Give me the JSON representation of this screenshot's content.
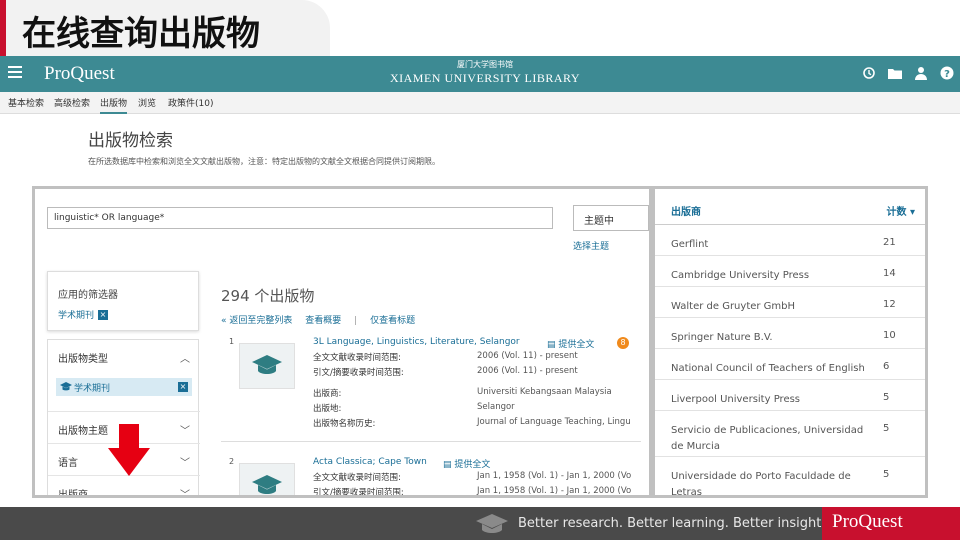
{
  "slide": {
    "title": "在线查询出版物"
  },
  "header": {
    "brand": "ProQuest",
    "library_sub": "厦门大学图书馆",
    "library_name": "XIAMEN UNIVERSITY LIBRARY",
    "icons": [
      "history-icon",
      "folder-icon",
      "user-icon",
      "help-icon"
    ]
  },
  "nav": {
    "items": [
      "基本检索",
      "高级检索",
      "出版物",
      "浏览",
      "政策件(10)"
    ],
    "active": "出版物"
  },
  "page": {
    "title": "出版物检索",
    "description": "在所选数据库中检索和浏览全文文献出版物，注意：特定出版物的文献全文根据合同提供订阅期限。"
  },
  "search": {
    "value": "linguistic* OR language*",
    "subject_button": "主题中",
    "select_subject": "选择主题"
  },
  "filters": {
    "applied_title": "应用的筛选器",
    "applied_chip": "学术期刊",
    "facets": [
      {
        "label": "出版物类型",
        "chevron": "︿",
        "selected": "学术期刊"
      },
      {
        "label": "出版物主题",
        "chevron": "﹀"
      },
      {
        "label": "语言",
        "chevron": "﹀"
      },
      {
        "label": "出版商",
        "chevron": "﹀"
      }
    ]
  },
  "results": {
    "count": "294 个出版物",
    "links": [
      "« 返回至完整列表",
      "查看概要",
      "|",
      "仅查看标题"
    ],
    "items": [
      {
        "num": "1",
        "title": "3L Language, Linguistics, Literature, Selangor",
        "fulltext": "提供全文",
        "badge": "8",
        "meta": [
          {
            "label": "全文文献收录时间范围:",
            "value": "2006 (Vol. 11) - present"
          },
          {
            "label": "引文/摘要收录时间范围:",
            "value": "2006 (Vol. 11) - present"
          },
          {
            "label": "出版商:",
            "value": "Universiti Kebangsaan Malaysia"
          },
          {
            "label": "出版地:",
            "value": "Selangor"
          },
          {
            "label": "出版物名称历史:",
            "value": "Journal of Language Teaching, Lingu"
          }
        ]
      },
      {
        "num": "2",
        "title": "Acta Classica; Cape Town",
        "fulltext": "提供全文",
        "meta": [
          {
            "label": "全文文献收录时间范围:",
            "value": "Jan 1, 1958 (Vol. 1) - Jan 1, 2000 (Vo"
          },
          {
            "label": "引文/摘要收录时间范围:",
            "value": "Jan 1, 1958 (Vol. 1) - Jan 1, 2000 (Vo"
          }
        ]
      }
    ]
  },
  "publisher_panel": {
    "header_name": "出版商",
    "header_count": "计数 ▾",
    "rows": [
      {
        "name": "Gerflint",
        "count": "21"
      },
      {
        "name": "Cambridge University Press",
        "count": "14"
      },
      {
        "name": "Walter de Gruyter GmbH",
        "count": "12"
      },
      {
        "name": "Springer Nature B.V.",
        "count": "10"
      },
      {
        "name": "National Council of Teachers of English",
        "count": "6"
      },
      {
        "name": "Liverpool University Press",
        "count": "5"
      },
      {
        "name": "Servicio de Publicaciones, Universidad de Murcia",
        "count": "5"
      },
      {
        "name": "Universidade do Porto Faculdade de Letras",
        "count": "5"
      }
    ]
  },
  "footer": {
    "tagline": "Better research. Better learning. Better insights.",
    "logo": "ProQuest"
  },
  "colors": {
    "header": "#3d8a93",
    "link": "#1a6e96",
    "accent_red": "#c8102e",
    "footer": "#4a4a4a",
    "badge_orange": "#f08a1c"
  }
}
